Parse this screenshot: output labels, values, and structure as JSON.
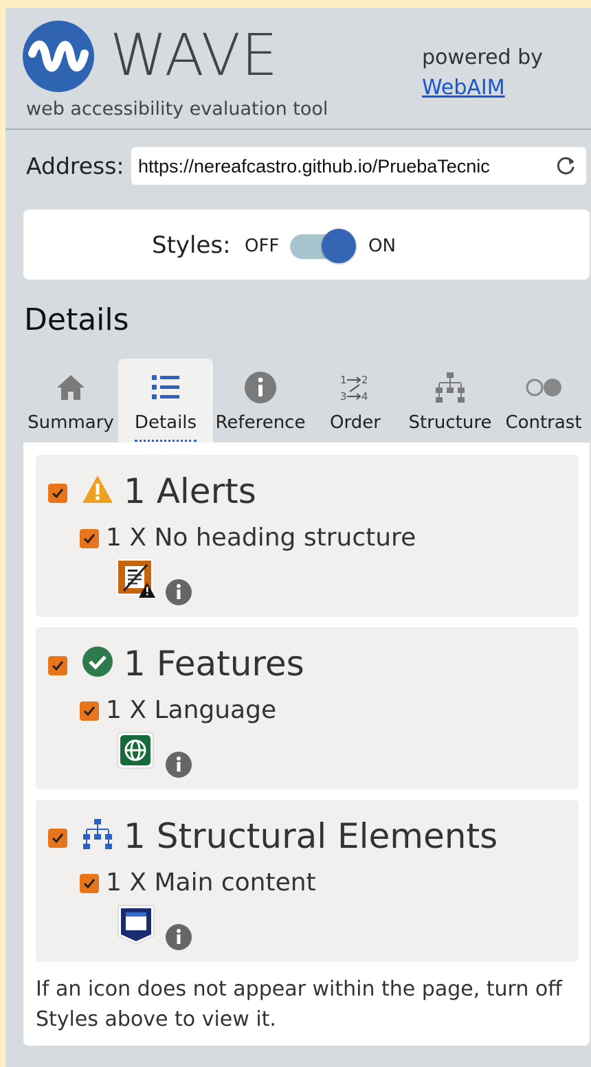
{
  "header": {
    "brand": "WAVE",
    "tagline": "web accessibility evaluation tool",
    "powered_by": "powered by",
    "webaim_link": "WebAIM"
  },
  "address": {
    "label": "Address:",
    "value": "https://nereafcastro.github.io/PruebaTecnic"
  },
  "styles": {
    "label": "Styles:",
    "off": "OFF",
    "on": "ON",
    "state": "on"
  },
  "panel_title": "Details",
  "tabs": [
    {
      "label": "Summary",
      "icon": "home-icon"
    },
    {
      "label": "Details",
      "icon": "list-icon",
      "active": true
    },
    {
      "label": "Reference",
      "icon": "info-icon"
    },
    {
      "label": "Order",
      "icon": "order-icon"
    },
    {
      "label": "Structure",
      "icon": "structure-icon"
    },
    {
      "label": "Contrast",
      "icon": "contrast-icon"
    }
  ],
  "sections": [
    {
      "title": "1 Alerts",
      "icon": "alert-icon",
      "item": "1 X No heading structure",
      "item_icon": "no-heading-structure-icon"
    },
    {
      "title": "1 Features",
      "icon": "feature-check-icon",
      "item": "1 X Language",
      "item_icon": "language-globe-icon"
    },
    {
      "title": "1 Structural Elements",
      "icon": "structure-icon",
      "item": "1 X Main content",
      "item_icon": "main-content-icon"
    }
  ],
  "footnote": "If an icon does not appear within the page, turn off Styles above to view it.",
  "colors": {
    "brand_blue": "#2f64b3",
    "checkbox_orange": "#e8751a",
    "alert_orange": "#f0a020",
    "feature_green": "#2f7a4a",
    "link_blue": "#1a55c9"
  }
}
